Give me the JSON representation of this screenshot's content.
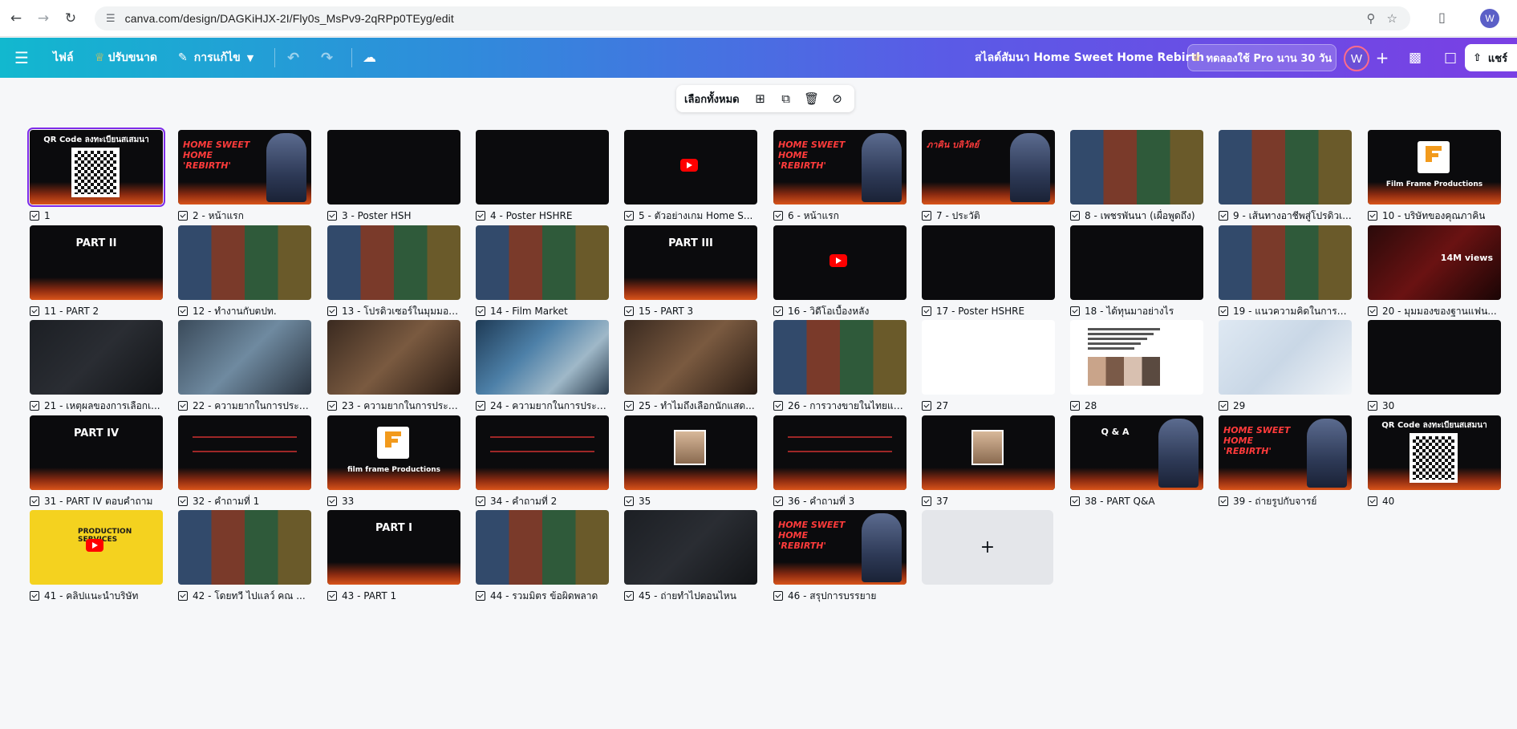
{
  "browser": {
    "url": "canva.com/design/DAGKiHJX-2I/Fly0s_MsPv9-2qRPp0TEyg/edit",
    "profile_initial": "W"
  },
  "topbar": {
    "file_label": "ไฟล์",
    "resize_label": "ปรับขนาด",
    "edit_label": "การแก้ไข",
    "design_title": "สไลด์สัมนา Home Sweet Home Rebirth",
    "pro_trial_label": "ทดลองใช้ Pro นาน 30 วัน",
    "avatar_initial": "W",
    "share_label": "แชร์"
  },
  "selection_toolbar": {
    "select_all_label": "เลือกทั้งหมด"
  },
  "slides": [
    {
      "label": "1",
      "style": "qr",
      "text": "QR Code ลงทะเบียนสเสมนา"
    },
    {
      "label": "2 - หน้าแรก",
      "style": "title",
      "text": "HOME SWEET HOME 'REBIRTH'"
    },
    {
      "label": "3 - Poster HSH",
      "style": "dark"
    },
    {
      "label": "4 - Poster HSHRE",
      "style": "dark"
    },
    {
      "label": "5 - ตัวอย่างเกม Home S...",
      "style": "video"
    },
    {
      "label": "6 - หน้าแรก",
      "style": "title",
      "text": "HOME SWEET HOME 'REBIRTH'"
    },
    {
      "label": "7 - ประวัติ",
      "style": "title",
      "text": "ภาคิน บลิวัลย์"
    },
    {
      "label": "8 - เพชรพันนา (เผื่อพูดถึง)",
      "style": "collage"
    },
    {
      "label": "9 - เส้นทางอาชีพสู่โปรดิวเ...",
      "style": "collage"
    },
    {
      "label": "10 - บริษัทของคุณภาคิน",
      "style": "brand",
      "text": "Film Frame Productions"
    },
    {
      "label": "11 - PART 2",
      "style": "part",
      "text": "PART II"
    },
    {
      "label": "12 - ทำงานกับตปท.",
      "style": "collage"
    },
    {
      "label": "13 - โปรดิวเซอร์ในมุมมอง...",
      "style": "collage"
    },
    {
      "label": "14 - Film Market",
      "style": "collage"
    },
    {
      "label": "15 - PART 3",
      "style": "part",
      "text": "PART III"
    },
    {
      "label": "16 - วิดีโอเบื้องหลัง",
      "style": "video"
    },
    {
      "label": "17 - Poster HSHRE",
      "style": "dark"
    },
    {
      "label": "18 - ได้ทุนมาอย่างไร",
      "style": "dark"
    },
    {
      "label": "19 - แนวความคิดในการพั...",
      "style": "collage"
    },
    {
      "label": "20 - มุมมองของฐานแฟน...",
      "style": "red",
      "text": "14M views"
    },
    {
      "label": "21 - เหตุผลของการเลือกเ...",
      "style": "photo-dark"
    },
    {
      "label": "22 - ความยากในการประส...",
      "style": "photo-blue"
    },
    {
      "label": "23 - ความยากในการประส...",
      "style": "photo-warm"
    },
    {
      "label": "24 - ความยากในการประส...",
      "style": "photo-crowd"
    },
    {
      "label": "25 - ทำไมถึงเลือกนักแสด...",
      "style": "photo-warm"
    },
    {
      "label": "26 - การวางขายในไทยแล...",
      "style": "collage"
    },
    {
      "label": "27",
      "style": "photo-white"
    },
    {
      "label": "28",
      "style": "article"
    },
    {
      "label": "29",
      "style": "photo-light"
    },
    {
      "label": "30",
      "style": "black"
    },
    {
      "label": "31 - PART IV ตอบคำถาม",
      "style": "part",
      "text": "PART IV"
    },
    {
      "label": "32 - คำถามที่ 1",
      "style": "question"
    },
    {
      "label": "33",
      "style": "brand",
      "text": "film frame Productions"
    },
    {
      "label": "34 - คำถามที่ 2",
      "style": "question"
    },
    {
      "label": "35",
      "style": "person"
    },
    {
      "label": "36 - คำถามที่ 3",
      "style": "question"
    },
    {
      "label": "37",
      "style": "person"
    },
    {
      "label": "38 - PART Q&A",
      "style": "qa",
      "text": "Q & A"
    },
    {
      "label": "39 - ถ่ายรูปกับจารย์",
      "style": "title",
      "text": "HOME SWEET HOME 'REBIRTH'"
    },
    {
      "label": "40",
      "style": "qr",
      "text": "QR Code ลงทะเบียนสเสมนา"
    },
    {
      "label": "41 - คลิปแนะนำบริษัท",
      "style": "yellow",
      "text": "PRODUCTION SERVICES"
    },
    {
      "label": "42 - โดยทวี ไปแลว์ คณ ...",
      "style": "collage"
    },
    {
      "label": "43 - PART 1",
      "style": "part",
      "text": "PART I"
    },
    {
      "label": "44 - รวมมิตร ข้อผิดพลาด",
      "style": "collage"
    },
    {
      "label": "45 - ถ่ายทำไปตอนไหน",
      "style": "photo-dark"
    },
    {
      "label": "46 - สรุปการบรรยาย",
      "style": "title",
      "text": "HOME SWEET HOME 'REBIRTH'"
    }
  ],
  "add_slide_label": "+"
}
